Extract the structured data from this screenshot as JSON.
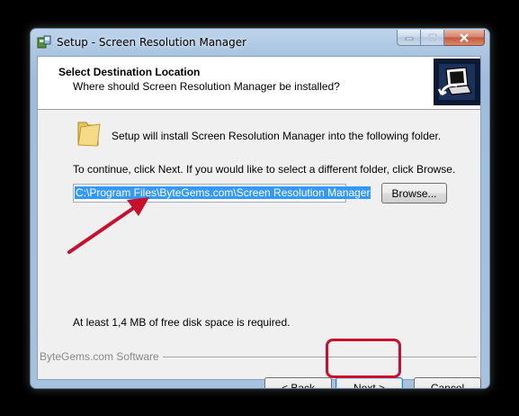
{
  "window": {
    "title": "Setup - Screen Resolution Manager"
  },
  "header": {
    "title": "Select Destination Location",
    "subtitle": "Where should Screen Resolution Manager be installed?"
  },
  "content": {
    "info_line": "Setup will install Screen Resolution Manager into the following folder.",
    "instruction": "To continue, click Next. If you would like to select a different folder, click Browse.",
    "path_value": "C:\\Program Files\\ByteGems.com\\Screen Resolution Manager",
    "browse_label": "Browse...",
    "disk_space": "At least 1,4 MB of free disk space is required."
  },
  "footer": {
    "brand": "ByteGems.com Software",
    "back_prefix": "< ",
    "back_label": "Back",
    "next_label": "Next >",
    "cancel_label": "Cancel"
  },
  "annotations": {
    "arrow_color": "#c8102e",
    "highlight_color": "#c8102e"
  },
  "icons": [
    "setup-app-icon",
    "minimize-icon",
    "maximize-icon",
    "close-icon",
    "computer-install-icon",
    "folder-icon"
  ]
}
